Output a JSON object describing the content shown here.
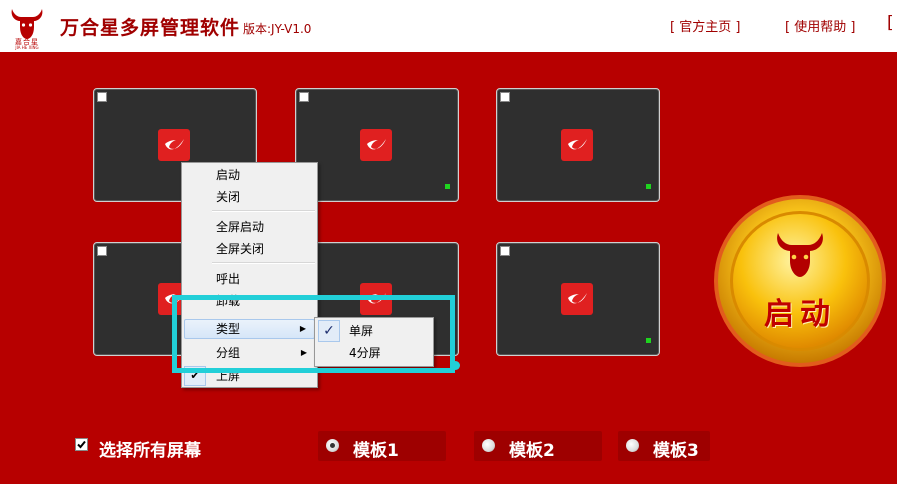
{
  "header": {
    "logo_text": "嘉合星",
    "logo_subtext": "JIA HE XING",
    "title": "万合星多屏管理软件",
    "version": "版本:JY-V1.0",
    "nav": [
      {
        "label": "官方主页"
      },
      {
        "label": "使用帮助"
      }
    ]
  },
  "screens": [
    {
      "id": "screen-1",
      "status_dot": false
    },
    {
      "id": "screen-2",
      "status_dot": true
    },
    {
      "id": "screen-3",
      "status_dot": true
    },
    {
      "id": "screen-4",
      "status_dot": false
    },
    {
      "id": "screen-5",
      "status_dot": false
    },
    {
      "id": "screen-6",
      "status_dot": true
    }
  ],
  "start_button": {
    "label": "启动"
  },
  "context_menu": {
    "items": [
      "启动",
      "关闭",
      "全屏启动",
      "全屏关闭",
      "呼出",
      "卸载",
      "类型",
      "分组",
      "上屏"
    ],
    "submenu_items": [
      "单屏",
      "4分屏"
    ],
    "submenu_check": "✓"
  },
  "bottom": {
    "select_all_label": "选择所有屏幕",
    "templates": [
      "模板1",
      "模板2",
      "模板3"
    ],
    "selected_template": "模板1"
  },
  "colors": {
    "background": "#b70000",
    "highlight": "#22cfd8",
    "status_dot": "#1fd41f",
    "accent_gold": "#f4b400"
  }
}
